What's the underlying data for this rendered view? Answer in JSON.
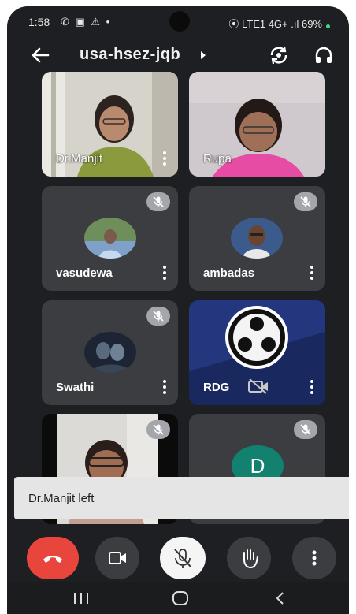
{
  "status_bar": {
    "time": "1:58",
    "left_icons": "✆ ▣ ⚠ •",
    "right_text": "⦿ LTE1 4G+ .ıl 69%",
    "battery_percent": "69%"
  },
  "header": {
    "title": "usa-hsez-jqb",
    "back_icon": "arrow-back-icon",
    "rotate_icon": "switch-camera-icon",
    "audio_icon": "headphones-icon"
  },
  "participants": [
    {
      "name": "Dr.Manjit",
      "kind": "video"
    },
    {
      "name": "Rupa",
      "kind": "video"
    },
    {
      "name": "vasudewa",
      "kind": "photo",
      "muted": true
    },
    {
      "name": "ambadas",
      "kind": "photo",
      "muted": true
    },
    {
      "name": "Swathi",
      "kind": "photo",
      "muted": true
    },
    {
      "name": "RDG",
      "kind": "logo",
      "camera_off": true
    },
    {
      "name": "",
      "kind": "video",
      "muted": true
    },
    {
      "name": "",
      "kind": "initial",
      "initial": "D",
      "muted": true
    }
  ],
  "toast": {
    "text": "Dr.Manjit left"
  },
  "controls": {
    "end_call": "end-call-icon",
    "camera": "video-camera-icon",
    "mic": "mic-off-icon",
    "raise_hand": "hand-icon",
    "more": "more-vert-icon"
  },
  "colors": {
    "end_call": "#e8453c",
    "tile": "#3c3d41",
    "background": "#1e1f22",
    "initial_avatar": "#12816f"
  },
  "nav": {
    "recents": "recents-icon",
    "home": "home-icon",
    "back": "back-icon"
  }
}
